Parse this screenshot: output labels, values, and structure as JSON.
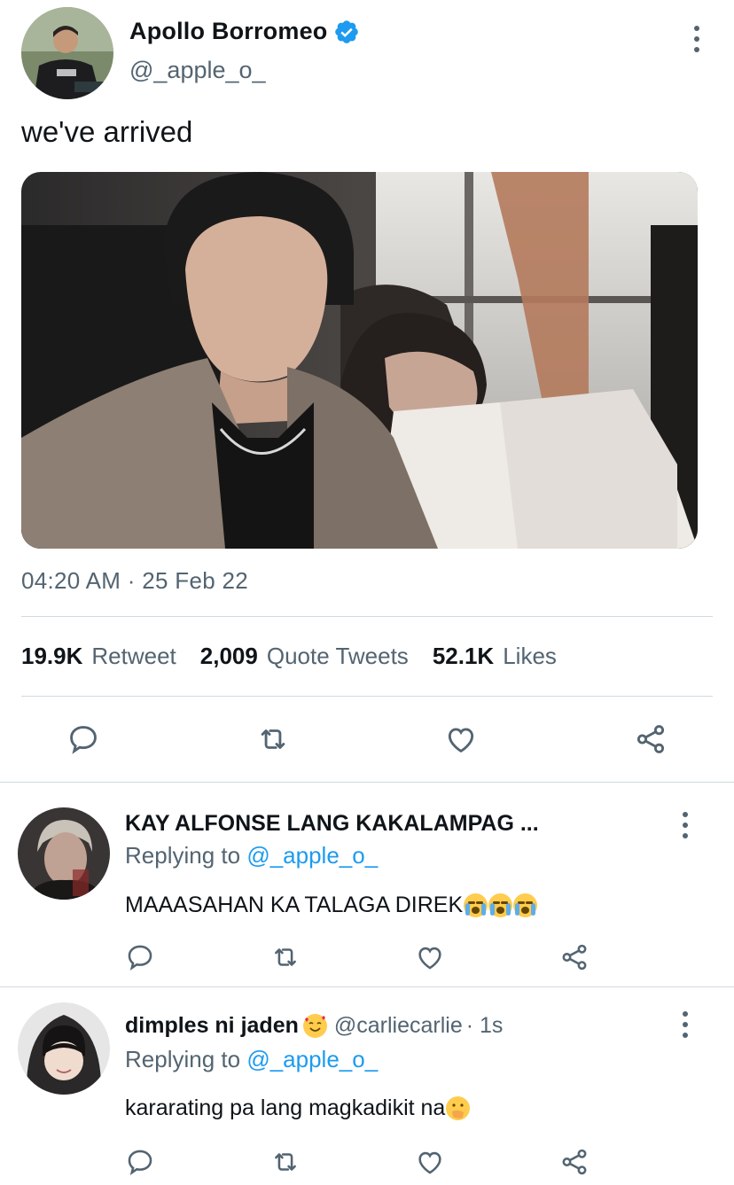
{
  "tweet": {
    "author_name": "Apollo Borromeo",
    "author_handle": "@_apple_o_",
    "text": "we've arrived",
    "timestamp": "04:20 AM · 25 Feb 22",
    "stats": {
      "retweets_count": "19.9K",
      "retweets_label": "Retweet",
      "quotes_count": "2,009",
      "quotes_label": "Quote Tweets",
      "likes_count": "52.1K",
      "likes_label": "Likes"
    }
  },
  "replies": [
    {
      "name": "KAY ALFONSE LANG KAKALAMPAG ...",
      "handle": "",
      "time": "",
      "replying_prefix": "Replying to ",
      "replying_to": "@_apple_o_",
      "text": "MAAASAHAN KA TALAGA DIREK",
      "emoji": [
        "loudly-crying-face",
        "loudly-crying-face",
        "loudly-crying-face"
      ]
    },
    {
      "name": "dimples ni jaden",
      "name_emoji": "smiling-face-with-hearts",
      "handle": "@carliecarlie",
      "time": "· 1s",
      "replying_prefix": "Replying to ",
      "replying_to": "@_apple_o_",
      "text": "kararating pa lang magkadikit na",
      "emoji": [
        "face-with-hand-over-mouth"
      ]
    }
  ],
  "colors": {
    "accent": "#1d9bf0",
    "secondary_text": "#536471",
    "divider": "#cfd9de",
    "primary_text": "#0f1419"
  },
  "icons": [
    "verified-badge-icon",
    "more-options-icon",
    "reply-icon",
    "retweet-icon",
    "like-icon",
    "share-icon"
  ]
}
